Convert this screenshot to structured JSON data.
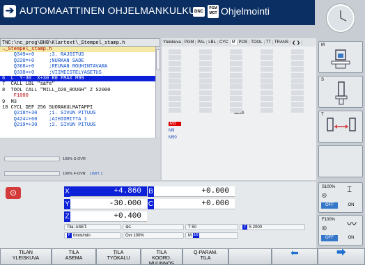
{
  "header": {
    "mode_title": "AUTOMAATTINEN OHJELMANKULKU",
    "dnc_label": "DNC",
    "pgm_label_1": "PGM",
    "pgm_label_2": "MGT",
    "mode2_title": "Ohjelmointi"
  },
  "program": {
    "path": "TNC:\\nc_prog\\BHB\\Klartext\\_Stempel_stamp.h",
    "lines": [
      {
        "text": "→_Stempel_stamp.h",
        "cls": "red"
      },
      {
        "text": "    Q349=+0     ;3. RAJOITUS",
        "cls": "blue"
      },
      {
        "text": "    Q220=+0     ;NURKAN SADE",
        "cls": "blue"
      },
      {
        "text": "    Q368=+0     ;REUNAN ROUHINTAVARA",
        "cls": "blue"
      },
      {
        "text": "    Q338=+0     ;VIIMEISTELYASETUS",
        "cls": "blue"
      },
      {
        "text": "6  L  Y-30  X+30 R0 FMAX M99",
        "cls": "hl"
      },
      {
        "text": "7  CALL LBL \"safe\"",
        "cls": ""
      },
      {
        "text": "8  TOOL CALL \"MILL_D20_ROUGH\" Z S2000",
        "cls": ""
      },
      {
        "text": "    F1000",
        "cls": "red"
      },
      {
        "text": "9  M3",
        "cls": ""
      },
      {
        "text": "10 CYCL DEF 256 SUORAKULMATAPPI",
        "cls": ""
      },
      {
        "text": "    Q218=+30    ;1. SIVUN PITUUS",
        "cls": "blue"
      },
      {
        "text": "    Q424=+60    ;AIHIOMITTA 1",
        "cls": "blue"
      },
      {
        "text": "    Q219=+30    ;2. SIVUN PITUUS",
        "cls": "blue"
      }
    ]
  },
  "overrides": {
    "s_ovr": "100% S-OVR",
    "f_ovr": "100% F-OVR",
    "limit": "LIMIT 1"
  },
  "tabs": [
    "Yleiskuva",
    "PGM",
    "PAL",
    "LBL",
    "CYC",
    "M",
    "POS",
    "TOOL",
    "TT",
    "TRANS"
  ],
  "tab_arrows": "❮ ❯",
  "status_pane": {
    "oem_label": "OEM",
    "m_functions": [
      "M3",
      "M9",
      "M50"
    ]
  },
  "right_softkeys": {
    "m": "M",
    "s": "S",
    "t": "T"
  },
  "axes": {
    "x_label": "X",
    "x_value": "+4.860",
    "y_label": "Y",
    "y_value": "-30.000",
    "z_label": "Z",
    "z_value": "+0.400",
    "b_label": "B",
    "b_value": "+0.000",
    "c_label": "C",
    "c_value": "+0.000"
  },
  "status": {
    "tila": "Tila: ASET.",
    "preset": "1",
    "tool": "T 50",
    "spindle_axis": "Z",
    "spindle_speed": "S 2000",
    "feed": "0mm/min",
    "ovr": "Ovr 100%",
    "m_prefix": "M",
    "m_value": "5/9"
  },
  "feed_panel": {
    "s_pct": "S100%",
    "f_pct": "F100%",
    "off": "OFF",
    "on": "ON"
  },
  "softkeys": [
    {
      "l1": "TILAN",
      "l2": "YLEISKUVA"
    },
    {
      "l1": "TILA",
      "l2": "ASEMA"
    },
    {
      "l1": "TILA",
      "l2": "TYÖKALU"
    },
    {
      "l1": "TILA",
      "l2": "KOORD.",
      "l3": "MUUNNOS"
    },
    {
      "l1": "Q-PARAM.",
      "l2": "TILA"
    },
    {
      "l1": "",
      "l2": ""
    },
    {
      "l1": "",
      "l2": ""
    },
    {
      "l1": "",
      "l2": ""
    }
  ],
  "colors": {
    "header_bg": "#0b2f63",
    "highlight": "#0c21d8",
    "accent_red": "#e00000"
  }
}
